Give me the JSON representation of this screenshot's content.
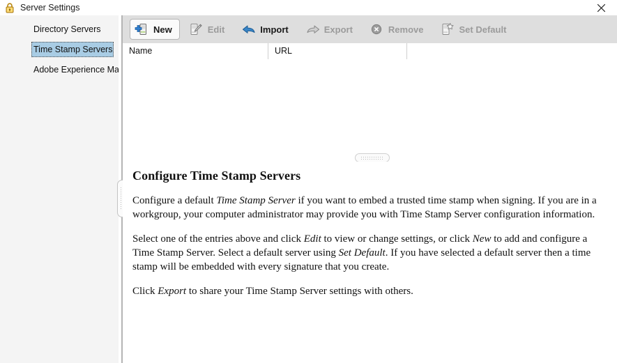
{
  "window": {
    "title": "Server Settings",
    "icon": "lock-icon",
    "close_label": "✕",
    "accent_selected": "#a8cce4",
    "toolbar_bg": "#dedede",
    "sidebar_bg": "#f4f4f4"
  },
  "sidebar": {
    "items": [
      {
        "label": "Directory Servers",
        "selected": false
      },
      {
        "label": "Time Stamp Servers",
        "selected": true
      },
      {
        "label": "Adobe Experience Manag",
        "selected": false
      }
    ]
  },
  "toolbar": {
    "buttons": [
      {
        "label": "New",
        "icon": "new-server-icon",
        "enabled": true,
        "hover": true
      },
      {
        "label": "Edit",
        "icon": "edit-pencil-icon",
        "enabled": false,
        "hover": false
      },
      {
        "label": "Import",
        "icon": "import-arrow-icon",
        "enabled": true,
        "hover": false
      },
      {
        "label": "Export",
        "icon": "export-arrow-icon",
        "enabled": false,
        "hover": false
      },
      {
        "label": "Remove",
        "icon": "remove-circle-x-icon",
        "enabled": false,
        "hover": false
      },
      {
        "label": "Set Default",
        "icon": "set-default-star-icon",
        "enabled": false,
        "hover": false
      }
    ]
  },
  "list": {
    "columns": [
      {
        "label": "Name"
      },
      {
        "label": "URL"
      }
    ],
    "rows": []
  },
  "help": {
    "title": "Configure Time Stamp Servers",
    "paragraph1_part1": "Configure a default ",
    "paragraph1_em1": "Time Stamp Server",
    "paragraph1_part2": " if you want to embed a trusted time stamp when signing. If you are in a workgroup, your computer administrator may provide you with Time Stamp Server configuration information.",
    "paragraph2_part1": "Select one of the entries above and click ",
    "paragraph2_em1": "Edit",
    "paragraph2_part2": " to view or change settings, or click ",
    "paragraph2_em2": "New",
    "paragraph2_part3": " to add and configure a Time Stamp Server. Select a default server using ",
    "paragraph2_em3": "Set Default",
    "paragraph2_part4": ". If you have selected a default server then a time stamp will be embedded with every signature that you create.",
    "paragraph3_part1": "Click ",
    "paragraph3_em1": "Export",
    "paragraph3_part2": " to share your Time Stamp Server settings with others."
  },
  "splitters": {
    "vertical_grip": "vertical-splitter-grip",
    "horizontal_grip": "horizontal-splitter-grip"
  }
}
